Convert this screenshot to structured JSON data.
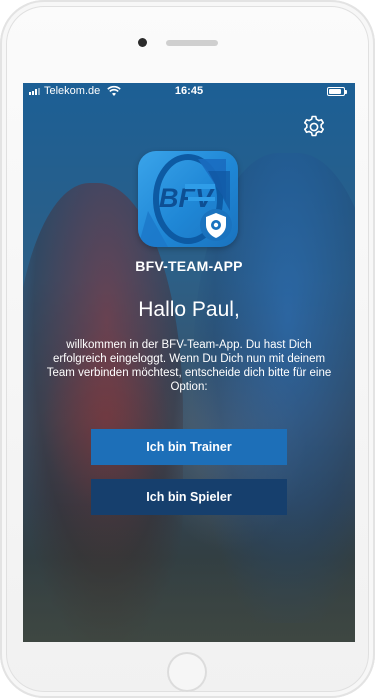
{
  "status_bar": {
    "carrier": "Telekom.de",
    "time": "16:45",
    "battery_level": 0.85,
    "signal_bars": 3,
    "signal_icon": "signal-icon",
    "wifi_icon": "wifi-icon",
    "battery_icon": "battery-icon"
  },
  "header": {
    "settings_icon": "gear-icon"
  },
  "app": {
    "icon_text": "BFV",
    "name": "BFV-TEAM-APP"
  },
  "main": {
    "greeting": "Hallo Paul,",
    "welcome_text": "willkommen in der BFV-Team-App. Du hast Dich erfolgreich eingeloggt. Wenn Du Dich nun mit deinem Team verbinden möchtest, entscheide dich bitte für eine Option:",
    "trainer_button": "Ich bin Trainer",
    "player_button": "Ich bin Spieler"
  },
  "colors": {
    "primary_button": "#1d6fb8",
    "secondary_button": "#163f6d",
    "app_icon": "#2a95e2"
  }
}
